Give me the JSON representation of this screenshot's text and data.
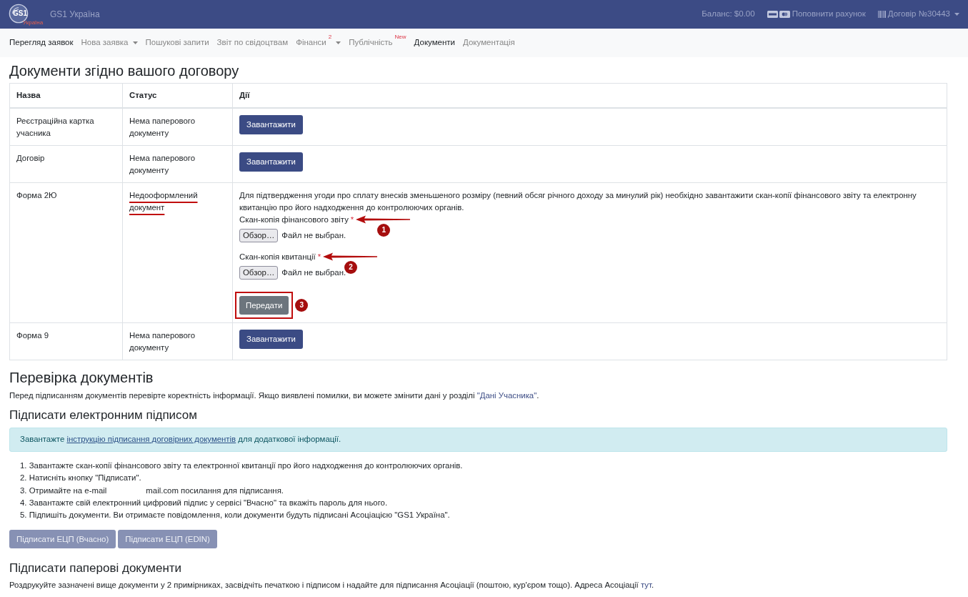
{
  "navbar": {
    "logo": {
      "mark": "GS1",
      "caption": "Україна"
    },
    "brand": "GS1 Україна",
    "balance": "Баланс: $0.00",
    "top_up": "Поповнити рахунок",
    "contract": "Договір №30443"
  },
  "menu": [
    {
      "label": "Перегляд заявок",
      "selected": true,
      "dropdown": false
    },
    {
      "label": "Нова заявка",
      "selected": false,
      "dropdown": true
    },
    {
      "label": "Пошукові запити",
      "selected": false,
      "dropdown": false
    },
    {
      "label": "Звіт по свідоцтвам",
      "selected": false,
      "dropdown": false
    },
    {
      "label": "Фінанси",
      "selected": false,
      "dropdown": true,
      "badge": "2"
    },
    {
      "label": "Публічність",
      "selected": false,
      "dropdown": false,
      "badge": "New"
    },
    {
      "label": "Документи",
      "selected": true,
      "dropdown": false
    },
    {
      "label": "Документація",
      "selected": false,
      "dropdown": false
    }
  ],
  "documents": {
    "title": "Документи згідно вашого договору",
    "columns": [
      "Назва",
      "Статус",
      "Дії"
    ],
    "rows": [
      {
        "name": "Реєстраційна картка учасника",
        "status": "Нема паперового документу",
        "highlighted": false,
        "kind": "download",
        "button": "Завантажити"
      },
      {
        "name": "Договір",
        "status": "Нема паперового документу",
        "highlighted": false,
        "kind": "download",
        "button": "Завантажити"
      },
      {
        "name": "Форма 2Ю",
        "status": "Недооформлений документ",
        "highlighted": true,
        "kind": "upload",
        "description": "Для підтвердження угоди про сплату внесків зменьшеного розміру (певний обсяг річного доходу за минулий рік) необхідно завантажити скан-копії фінансового звіту та електронну квитанцію про його надходження до контролюючих органів.",
        "fields": [
          {
            "label": "Скан-копія фінансового звіту",
            "asterisk": "*",
            "browse": "Обзор…",
            "file": "Файл не выбран.",
            "marker": "1"
          },
          {
            "label": "Скан-копія квитанції",
            "asterisk": "*",
            "browse": "Обзор…",
            "file": "Файл не выбран.",
            "marker": "2"
          }
        ],
        "submit": {
          "label": "Передати",
          "highlighted": true,
          "marker": "3"
        }
      },
      {
        "name": "Форма 9",
        "status": "Нема паперового документу",
        "highlighted": false,
        "kind": "download",
        "button": "Завантажити"
      }
    ]
  },
  "review": {
    "title": "Перевірка документів",
    "text": "Перед підписанням документів перевірте коректність інформації. Якщо виявлені помилки, ви можете змінити дані у розділі ",
    "link": "\"Дані Учасника\"",
    "text_end": "."
  },
  "e_signature": {
    "title": "Підписати електронним підписом",
    "alert": {
      "before": "Завантажте ",
      "link": "інструкцію підписання договірних документів",
      "after": " для додаткової інформації."
    },
    "steps": [
      {
        "parts": [
          "1. Завантажте скан-копії фінансового звіту та електронної квитанції про його надходження до контролюючих органів."
        ]
      },
      {
        "parts": [
          "2. Натисніть кнопку \"Підписати\"."
        ]
      },
      {
        "parts": [
          "3. Отримайте на e-mail",
          "mail.com посилання для підписання."
        ]
      },
      {
        "parts": [
          "4. Завантажте свій електронний цифровий підпис у сервісі \"Вчасно\" та вкажіть пароль для нього."
        ]
      },
      {
        "parts": [
          "5. Підпишіть документи. Ви отримаєте повідомлення, коли документи будуть підписані Асоціацією \"GS1 Україна\"."
        ]
      }
    ],
    "buttons": [
      {
        "label": "Підписати ЕЦП (Вчасно)",
        "disabled": true
      },
      {
        "label": "Підписати ЕЦП (EDIN)",
        "disabled": true
      }
    ]
  },
  "paper": {
    "title": "Підписати паперові документи",
    "text": "Роздрукуйте зазначені вище документи у 2 примірниках, засвідчіть печаткою і підписом і надайте для підписання Асоціації (поштою, кур'єром тощо). Адреса Асоціації ",
    "link": "тут",
    "text_end": "."
  }
}
